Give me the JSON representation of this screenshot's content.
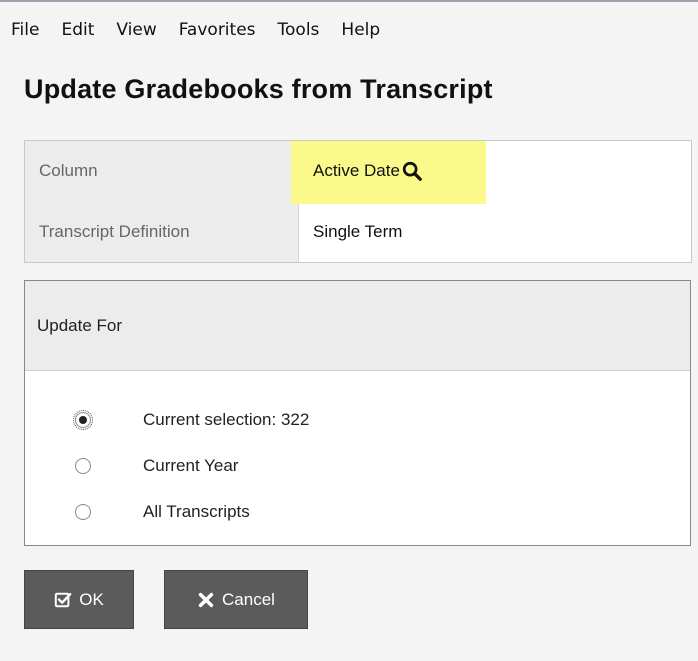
{
  "menu": [
    "File",
    "Edit",
    "View",
    "Favorites",
    "Tools",
    "Help"
  ],
  "title": "Update Gradebooks from Transcript",
  "properties": [
    {
      "label": "Column",
      "value": "Active Date"
    },
    {
      "label": "Transcript Definition",
      "value": "Single Term"
    }
  ],
  "update_for": {
    "header": "Update For",
    "options": [
      {
        "label": "Current selection: 322",
        "checked": true
      },
      {
        "label": "Current Year",
        "checked": false
      },
      {
        "label": "All Transcripts",
        "checked": false
      }
    ]
  },
  "buttons": {
    "ok_label": "OK",
    "cancel_label": "Cancel"
  },
  "colors": {
    "highlight": "#fbf98a",
    "button_bg": "#5b5b5b",
    "label_bg": "#ececec"
  },
  "icons": {
    "lookup": "search-icon",
    "ok": "check-square-icon",
    "cancel": "x-icon"
  }
}
